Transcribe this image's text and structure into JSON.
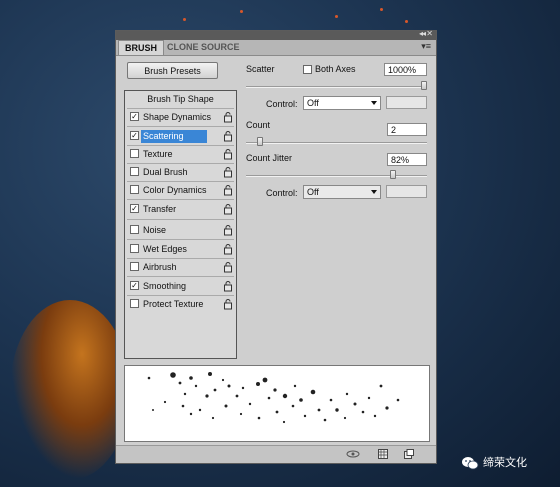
{
  "panel": {
    "tabs": [
      {
        "label": "BRUSH"
      },
      {
        "label": "CLONE SOURCE"
      }
    ],
    "brush_presets_label": "Brush Presets",
    "section_header": "Brush Tip Shape",
    "items": [
      {
        "label": "Shape Dynamics",
        "checked": true,
        "check": "✓"
      },
      {
        "label": "Scattering",
        "checked": true,
        "check": "✓",
        "selected": true
      },
      {
        "label": "Texture",
        "checked": false,
        "check": ""
      },
      {
        "label": "Dual Brush",
        "checked": false,
        "check": ""
      },
      {
        "label": "Color Dynamics",
        "checked": false,
        "check": ""
      },
      {
        "label": "Transfer",
        "checked": true,
        "check": "✓"
      },
      {
        "label": "Noise",
        "checked": false,
        "check": ""
      },
      {
        "label": "Wet Edges",
        "checked": false,
        "check": ""
      },
      {
        "label": "Airbrush",
        "checked": false,
        "check": ""
      },
      {
        "label": "Smoothing",
        "checked": true,
        "check": "✓"
      },
      {
        "label": "Protect Texture",
        "checked": false,
        "check": ""
      }
    ],
    "scatter": {
      "label": "Scatter",
      "both_axes_label": "Both Axes",
      "both_axes_checked": false,
      "value": "1000%",
      "slider_level": 1.0
    },
    "control1": {
      "label": "Control:",
      "value": "Off"
    },
    "count": {
      "label": "Count",
      "value": "2",
      "slider_level": 0.06
    },
    "count_jitter": {
      "label": "Count Jitter",
      "value": "82%",
      "slider_level": 0.82
    },
    "control2": {
      "label": "Control:",
      "value": "Off"
    }
  },
  "watermark": {
    "text": "缔荣文化"
  },
  "colors": {
    "selection": "#3a86d6",
    "panel": "#cfcfcf",
    "background": "#1d3552"
  }
}
